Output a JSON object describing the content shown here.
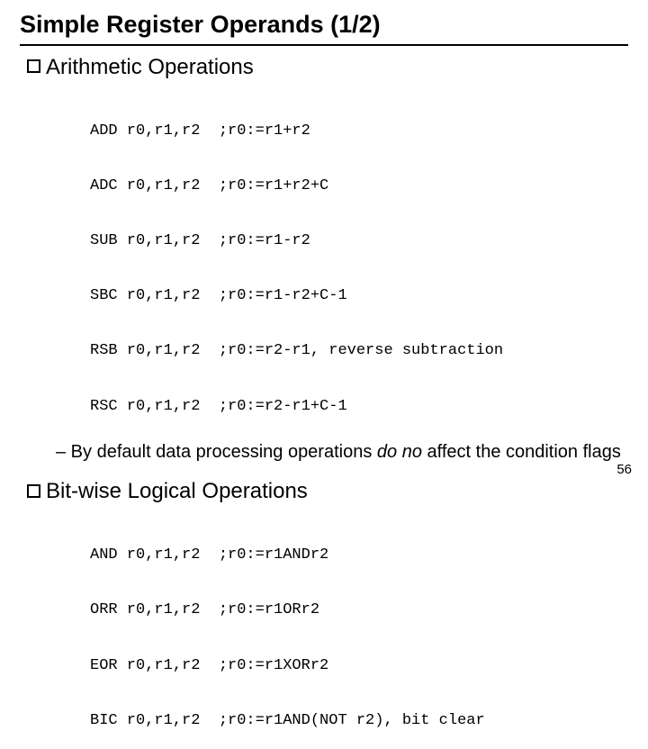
{
  "title": "Simple Register Operands (1/2)",
  "section1": {
    "heading": "Arithmetic Operations",
    "lines": [
      "ADD r0,r1,r2  ;r0:=r1+r2",
      "ADC r0,r1,r2  ;r0:=r1+r2+C",
      "SUB r0,r1,r2  ;r0:=r1-r2",
      "SBC r0,r1,r2  ;r0:=r1-r2+C-1",
      "RSB r0,r1,r2  ;r0:=r2-r1, reverse subtraction",
      "RSC r0,r1,r2  ;r0:=r2-r1+C-1"
    ],
    "note_prefix": "– By default data processing operations ",
    "note_em": "do no",
    "note_suffix": " affect the condition flags"
  },
  "section2": {
    "heading": "Bit-wise Logical Operations",
    "lines": [
      "AND r0,r1,r2  ;r0:=r1ANDr2",
      "ORR r0,r1,r2  ;r0:=r1ORr2",
      "EOR r0,r1,r2  ;r0:=r1XORr2",
      "BIC r0,r1,r2  ;r0:=r1AND(NOT r2), bit clear"
    ]
  },
  "page_number": "56"
}
